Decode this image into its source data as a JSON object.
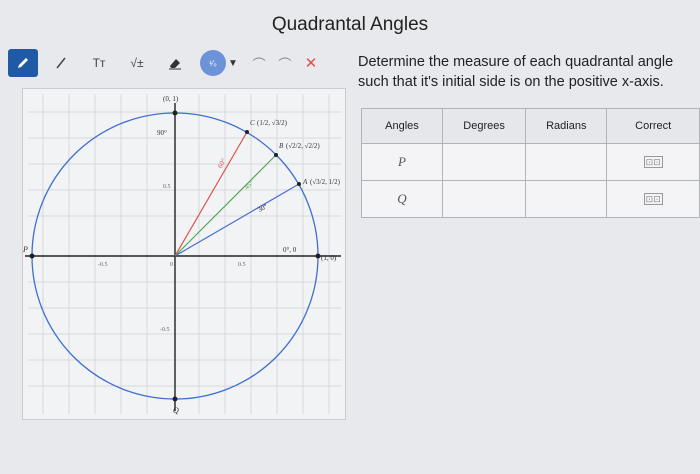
{
  "page": {
    "title": "Quadrantal Angles"
  },
  "toolbar": {
    "items": [
      {
        "icon": "pencil-icon"
      },
      {
        "icon": "line-icon"
      },
      {
        "label": "Tт"
      },
      {
        "label": "√±"
      },
      {
        "icon": "eraser-icon"
      },
      {
        "label": "¹⁄₀"
      },
      {
        "icon": "caret-down-icon"
      },
      {
        "icon": "undo-icon"
      },
      {
        "icon": "redo-icon"
      },
      {
        "icon": "close-icon"
      }
    ]
  },
  "instructions": "Determine the measure of each quadrantal angle such that it's initial side is on the positive x-axis.",
  "table": {
    "headers": [
      "Angles",
      "Degrees",
      "Radians",
      "Correct"
    ],
    "rows": [
      {
        "angle": "P",
        "degrees": "",
        "radians": "",
        "correct": "⊡⊡"
      },
      {
        "angle": "Q",
        "degrees": "",
        "radians": "",
        "correct": "⊡⊡"
      }
    ]
  },
  "graph": {
    "top_point": "(0, 1)",
    "right_point": "(1, 0)",
    "left_point_label": "P",
    "bottom_point_label": "Q",
    "tick_labels": {
      "x_neg": "-0.5",
      "x_zero": "0",
      "x_pos": "0.5",
      "y_pos": "0.5",
      "y_neg": "-0.5"
    },
    "angle_labels": {
      "ninety": "90°",
      "sixty": "60°",
      "fortyfive": "45°",
      "thirty": "30°",
      "zero": "0°, 0"
    },
    "points": {
      "A": {
        "name": "A",
        "coord": "(√3/2, 1/2)"
      },
      "B": {
        "name": "B",
        "coord": "(√2/2, √2/2)"
      },
      "C": {
        "name": "C",
        "coord": "(1/2, √3/2)"
      }
    },
    "colors": {
      "circle": "#3f6fd1",
      "sixty": "#d9534f",
      "fortyfive": "#5aa55a",
      "thirty": "#4a6fcf",
      "axes": "#222222"
    }
  }
}
